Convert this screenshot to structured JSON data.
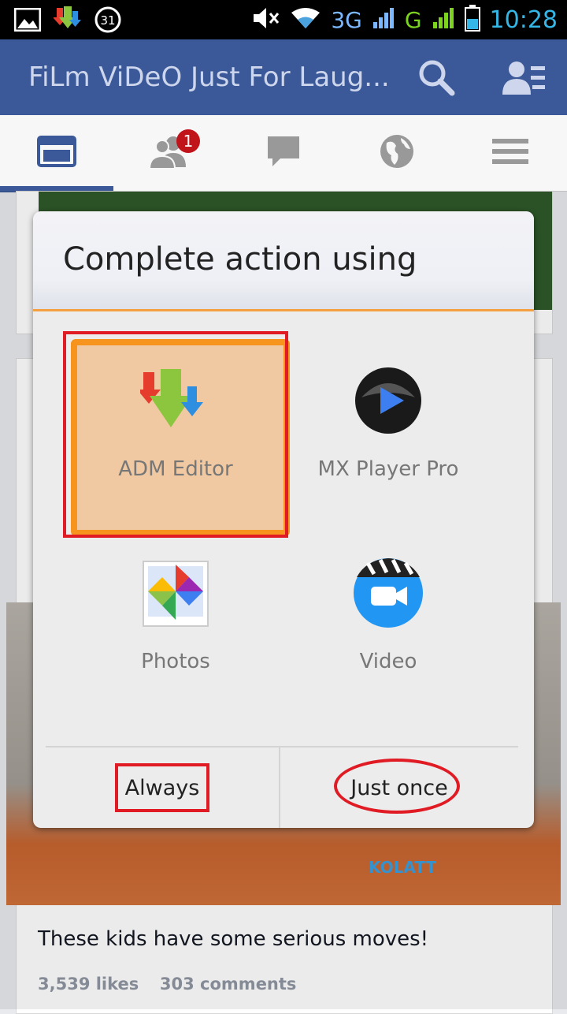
{
  "status_bar": {
    "network_label": "3G",
    "network2_label": "G",
    "time": "10:28",
    "calendar_day": "31"
  },
  "app_bar": {
    "title": "FiLm ViDeO Just For Laug..."
  },
  "tabs": {
    "friends_badge": "1"
  },
  "dialog": {
    "title": "Complete action using",
    "apps": [
      {
        "label": "ADM Editor",
        "selected": true
      },
      {
        "label": "MX Player Pro",
        "selected": false
      },
      {
        "label": "Photos",
        "selected": false
      },
      {
        "label": "Video",
        "selected": false
      }
    ],
    "always_label": "Always",
    "just_once_label": "Just once"
  },
  "feed": {
    "share_label": "KOLATT",
    "post_text": "These kids have some serious moves!",
    "likes": "3,539 likes",
    "comments": "303 comments"
  },
  "colors": {
    "facebook_blue": "#3b5998",
    "selected_orange": "#f7941d",
    "annotation_red": "#e01b24"
  }
}
